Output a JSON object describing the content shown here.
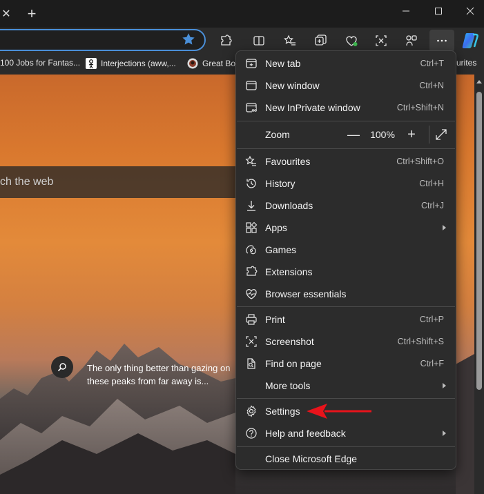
{
  "window": {
    "tab_close_glyph": "✕",
    "new_tab_glyph": "+"
  },
  "bookmarks": [
    {
      "label": "100 Jobs for Fantas...",
      "icon": "document-favicon"
    },
    {
      "label": "Interjections (aww,...",
      "icon": "figure-favicon"
    },
    {
      "label": "Great Bo",
      "icon": "circle-favicon"
    },
    {
      "label": "urites",
      "icon": ""
    }
  ],
  "new_tab_page": {
    "search_placeholder": "ch the web",
    "image_info": "The only thing better than gazing on these peaks from far away is..."
  },
  "menu": {
    "new_tab": {
      "label": "New tab",
      "shortcut": "Ctrl+T"
    },
    "new_window": {
      "label": "New window",
      "shortcut": "Ctrl+N"
    },
    "new_inprivate": {
      "label": "New InPrivate window",
      "shortcut": "Ctrl+Shift+N"
    },
    "zoom": {
      "label": "Zoom",
      "value": "100%",
      "minus": "—",
      "plus": "+"
    },
    "favourites": {
      "label": "Favourites",
      "shortcut": "Ctrl+Shift+O"
    },
    "history": {
      "label": "History",
      "shortcut": "Ctrl+H"
    },
    "downloads": {
      "label": "Downloads",
      "shortcut": "Ctrl+J"
    },
    "apps": {
      "label": "Apps"
    },
    "games": {
      "label": "Games"
    },
    "extensions": {
      "label": "Extensions"
    },
    "browser_essentials": {
      "label": "Browser essentials"
    },
    "print": {
      "label": "Print",
      "shortcut": "Ctrl+P"
    },
    "screenshot": {
      "label": "Screenshot",
      "shortcut": "Ctrl+Shift+S"
    },
    "find_on_page": {
      "label": "Find on page",
      "shortcut": "Ctrl+F"
    },
    "more_tools": {
      "label": "More tools"
    },
    "settings": {
      "label": "Settings"
    },
    "help_feedback": {
      "label": "Help and feedback"
    },
    "close_edge": {
      "label": "Close Microsoft Edge"
    }
  },
  "colors": {
    "accent": "#4a8fd8",
    "annotation_arrow": "#e8131b",
    "menu_bg": "#2c2c2c"
  }
}
